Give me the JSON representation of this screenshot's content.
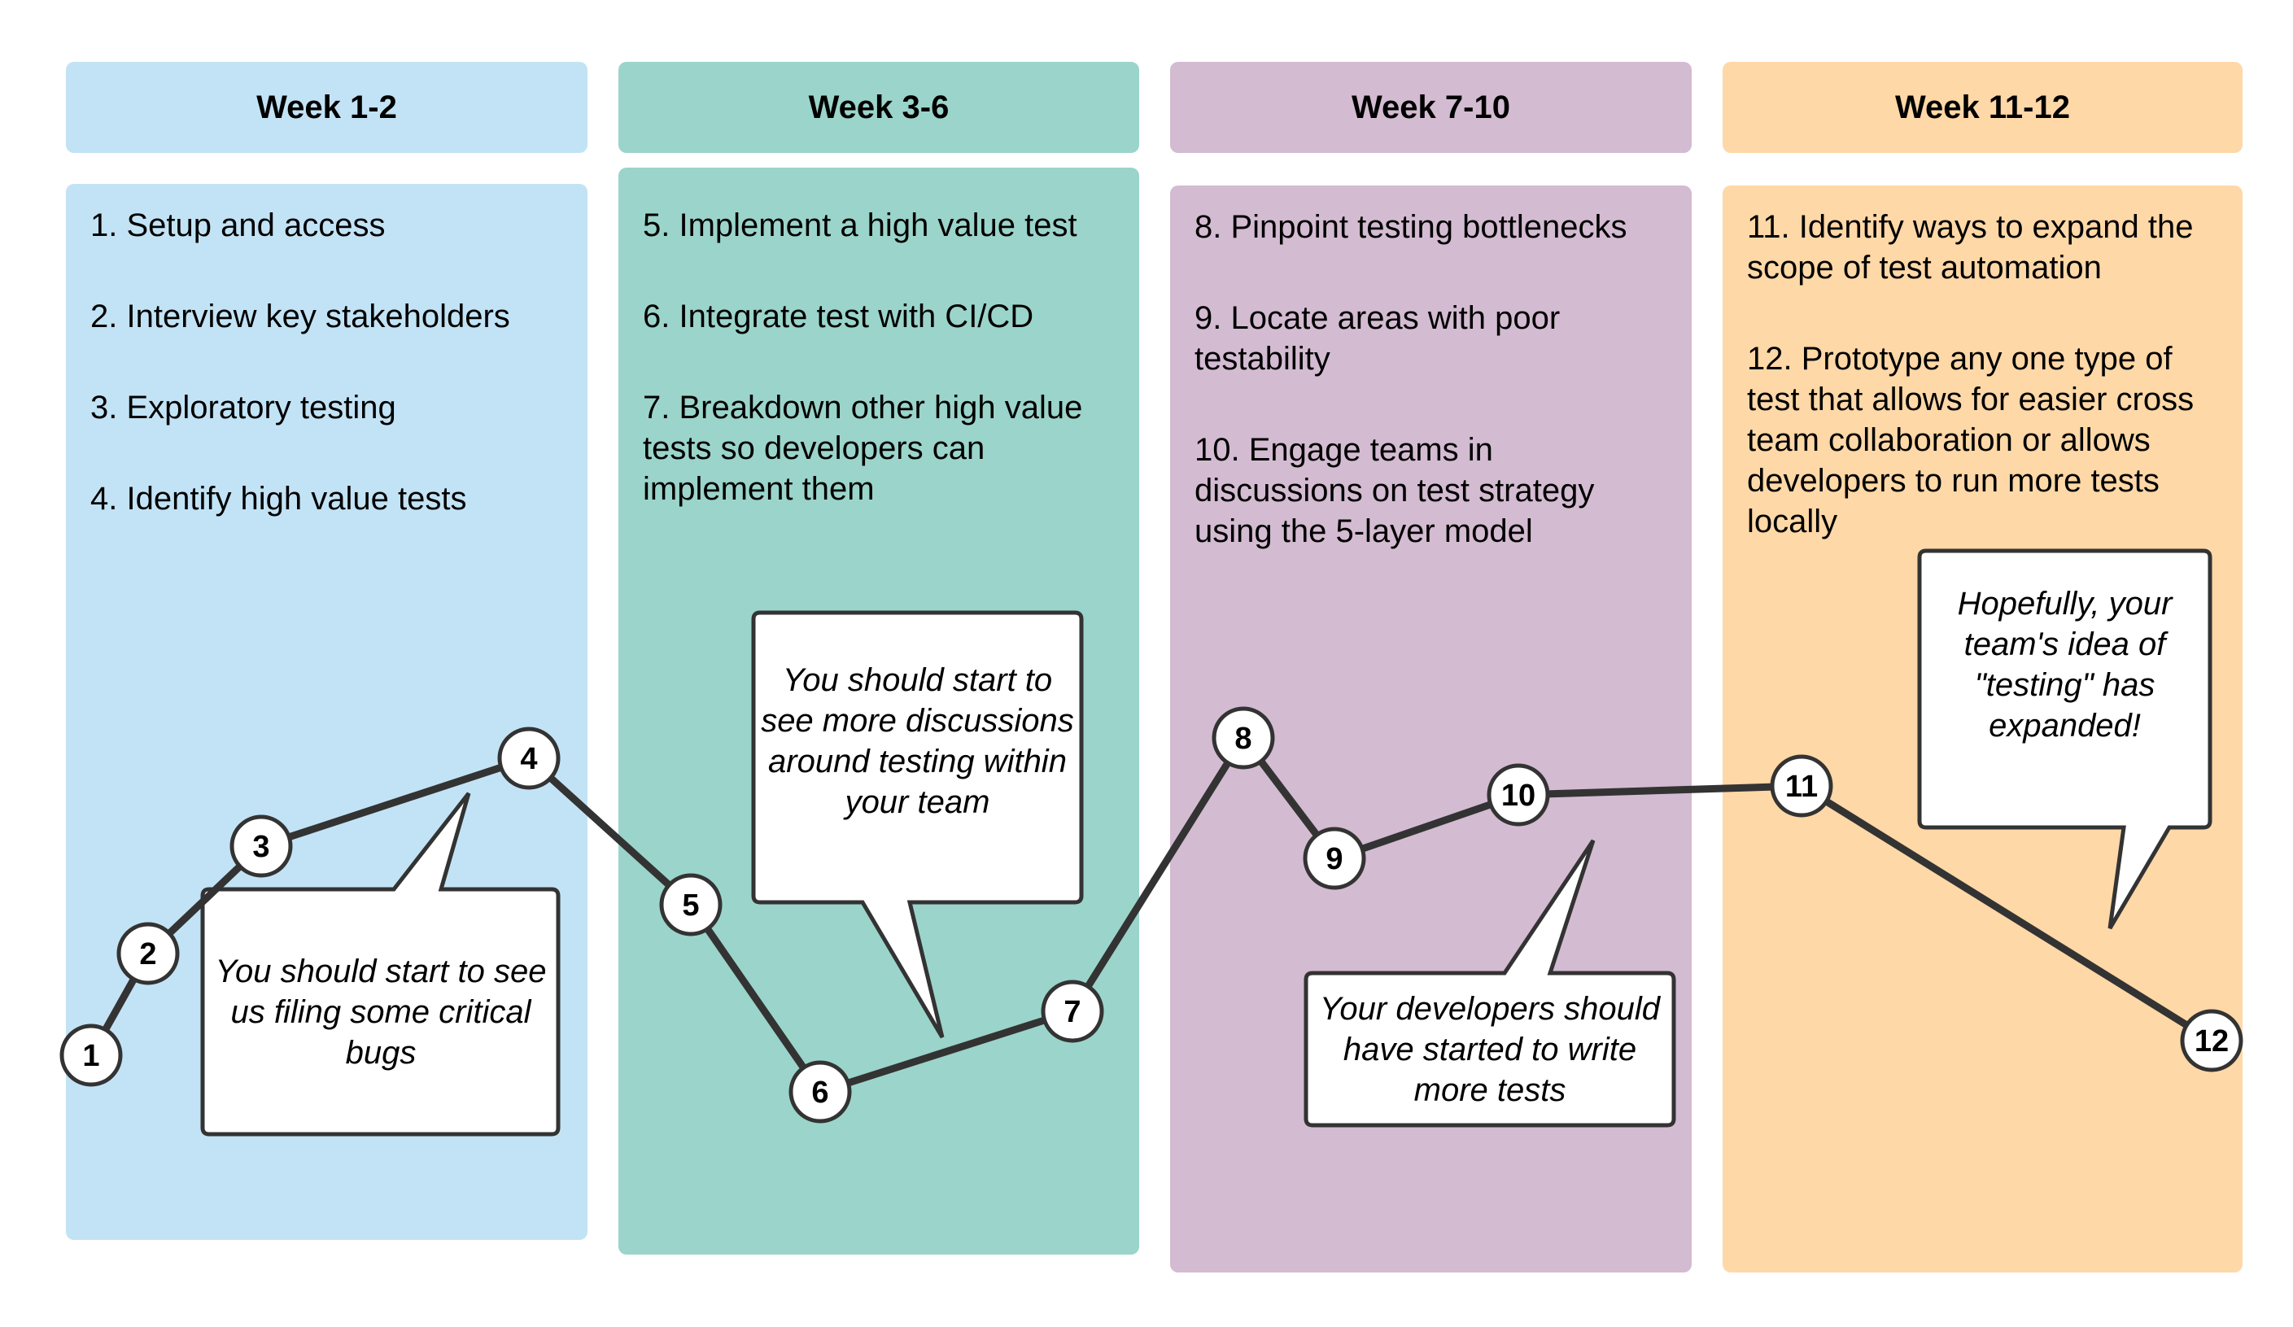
{
  "columns": [
    {
      "header": "Week 1-2",
      "color": "#c2e3f5",
      "items": [
        "1. Setup and access",
        "2. Interview key stakeholders",
        "3. Exploratory testing",
        "4. Identify high value tests"
      ]
    },
    {
      "header": "Week 3-6",
      "color": "#9bd4ca",
      "items": [
        "5. Implement a high value test",
        "6. Integrate test with CI/CD",
        "7. Breakdown other high value tests so developers can implement them"
      ]
    },
    {
      "header": "Week 7-10",
      "color": "#d3bbd1",
      "items": [
        "8. Pinpoint testing bottlenecks",
        "9. Locate areas with poor testability",
        "10. Engage teams in discussions on test strategy using the 5-layer model"
      ]
    },
    {
      "header": "Week 11-12",
      "color": "#fed8a7",
      "items": [
        "11. Identify ways to expand the scope of test automation",
        "12. Prototype any one type of test that allows for easier cross team collaboration or allows developers to run more tests locally"
      ]
    }
  ],
  "steps": [
    "1",
    "2",
    "3",
    "4",
    "5",
    "6",
    "7",
    "8",
    "9",
    "10",
    "11",
    "12"
  ],
  "callouts": [
    "You should start to see us filing some critical bugs",
    "You should start to see more discussions around testing within your team",
    "Your developers should have started to write more tests",
    "Hopefully, your team's idea of \"testing\" has expanded!"
  ],
  "colors": {
    "line": "#333333",
    "node_fill": "#ffffff",
    "callout_fill": "#ffffff"
  }
}
